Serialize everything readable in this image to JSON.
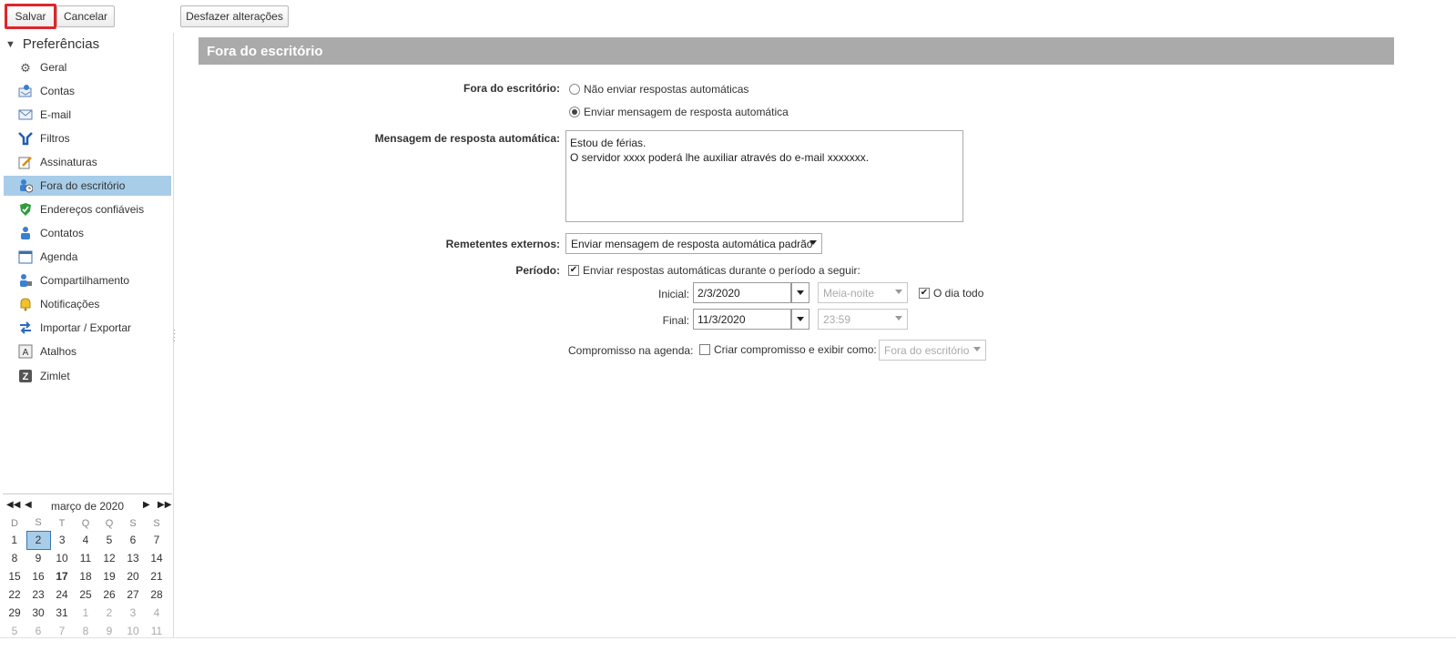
{
  "toolbar": {
    "save": "Salvar",
    "cancel": "Cancelar",
    "undo": "Desfazer alterações"
  },
  "sidebar": {
    "header": "Preferências",
    "items": [
      {
        "label": "Geral",
        "icon": "gear-icon"
      },
      {
        "label": "Contas",
        "icon": "accounts-icon"
      },
      {
        "label": "E-mail",
        "icon": "envelope-icon"
      },
      {
        "label": "Filtros",
        "icon": "filter-icon"
      },
      {
        "label": "Assinaturas",
        "icon": "signature-icon"
      },
      {
        "label": "Fora do escritório",
        "icon": "out-of-office-icon",
        "selected": true
      },
      {
        "label": "Endereços confiáveis",
        "icon": "shield-check-icon"
      },
      {
        "label": "Contatos",
        "icon": "contact-icon"
      },
      {
        "label": "Agenda",
        "icon": "calendar-icon"
      },
      {
        "label": "Compartilhamento",
        "icon": "share-icon"
      },
      {
        "label": "Notificações",
        "icon": "bell-icon"
      },
      {
        "label": "Importar / Exportar",
        "icon": "import-export-icon"
      },
      {
        "label": "Atalhos",
        "icon": "shortcut-icon"
      },
      {
        "label": "Zimlet",
        "icon": "zimlet-icon"
      }
    ]
  },
  "calendar": {
    "title": "março de 2020",
    "weekdays": [
      "D",
      "S",
      "T",
      "Q",
      "Q",
      "S",
      "S"
    ],
    "weeks": [
      [
        "1",
        "2",
        "3",
        "4",
        "5",
        "6",
        "7"
      ],
      [
        "8",
        "9",
        "10",
        "11",
        "12",
        "13",
        "14"
      ],
      [
        "15",
        "16",
        "17",
        "18",
        "19",
        "20",
        "21"
      ],
      [
        "22",
        "23",
        "24",
        "25",
        "26",
        "27",
        "28"
      ],
      [
        "29",
        "30",
        "31",
        "1",
        "2",
        "3",
        "4"
      ],
      [
        "5",
        "6",
        "7",
        "8",
        "9",
        "10",
        "11"
      ]
    ],
    "selected_day": "2",
    "today": "17"
  },
  "main": {
    "section_title": "Fora do escritório",
    "out_of_office_label": "Fora do escritório:",
    "radio_no_reply": "Não enviar respostas automáticas",
    "radio_send_reply": "Enviar mensagem de resposta automática",
    "message_label": "Mensagem de resposta automática:",
    "message_line1": "Estou de férias.",
    "message_line2": "O servidor xxxx poderá lhe auxiliar através do e-mail xxxxxxx.",
    "external_label": "Remetentes externos:",
    "external_value": "Enviar mensagem de resposta automática padrão",
    "period_label": "Período:",
    "period_check_label": "Enviar respostas automáticas durante o período a seguir:",
    "start_label": "Inicial:",
    "start_date": "2/3/2020",
    "start_time": "Meia-noite",
    "all_day_label": "O dia todo",
    "end_label": "Final:",
    "end_date": "11/3/2020",
    "end_time": "23:59",
    "agenda_label": "Compromisso na agenda:",
    "agenda_check_label": "Criar compromisso e exibir como:",
    "agenda_value": "Fora do escritório"
  }
}
